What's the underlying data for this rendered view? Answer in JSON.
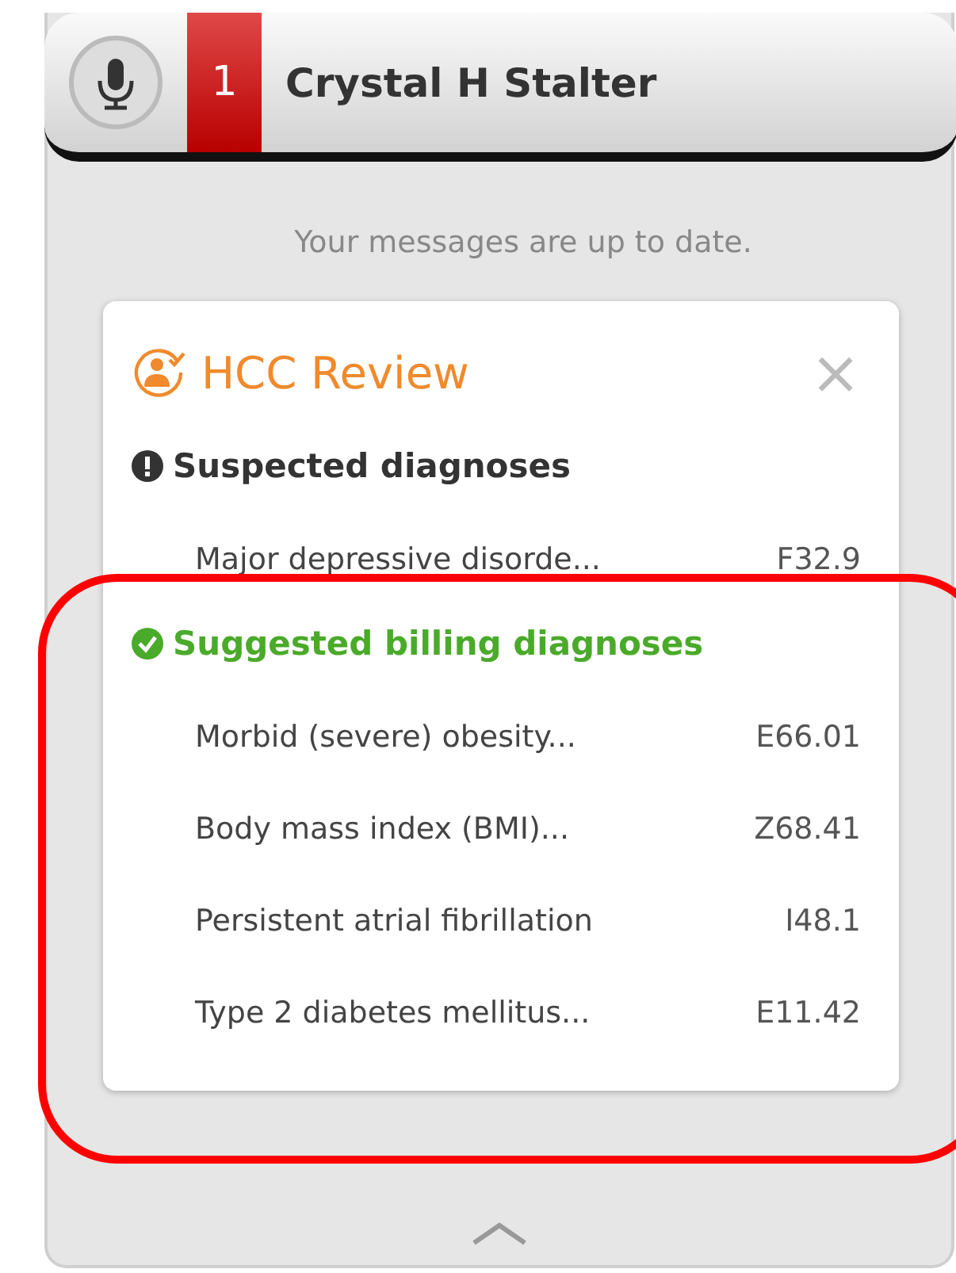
{
  "header": {
    "count": "1",
    "name": "Crystal H Stalter"
  },
  "status_message": "Your messages are up to date.",
  "card": {
    "title": "HCC Review",
    "close": "×",
    "sections": [
      {
        "kind": "warning",
        "title": "Suspected diagnoses",
        "items": [
          {
            "name": "Major depressive disorde...",
            "code": "F32.9"
          }
        ]
      },
      {
        "kind": "ok",
        "title": "Suggested billing diagnoses",
        "items": [
          {
            "name": "Morbid (severe) obesity...",
            "code": "E66.01"
          },
          {
            "name": "Body mass index (BMI)...",
            "code": "Z68.41"
          },
          {
            "name": "Persistent atrial fibrillation",
            "code": "I48.1"
          },
          {
            "name": "Type 2 diabetes mellitus...",
            "code": "E11.42"
          }
        ]
      }
    ]
  }
}
